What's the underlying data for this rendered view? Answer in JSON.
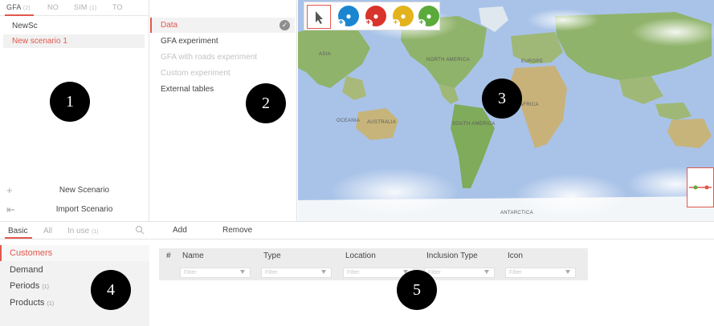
{
  "left_panel": {
    "mode_tabs": [
      {
        "label": "GFA",
        "count": "(2)"
      },
      {
        "label": "NO",
        "count": ""
      },
      {
        "label": "SIM",
        "count": "(1)"
      },
      {
        "label": "TO",
        "count": ""
      }
    ],
    "scenarios": [
      "NewSc",
      "New scenario 1"
    ],
    "actions": {
      "new_scenario": "New Scenario",
      "import_scenario": "Import Scenario"
    }
  },
  "data_panel": {
    "items": [
      "Data",
      "GFA experiment",
      "GFA with roads experiment",
      "Custom experiment",
      "External tables"
    ]
  },
  "map": {
    "labels": [
      "ASIA",
      "AUSTRALIA",
      "EUROPE",
      "AFRICA",
      "NORTH AMERICA",
      "SOUTH AMERICA",
      "OCEANIA",
      "ANTARCTICA"
    ],
    "tools": [
      "pointer-icon",
      "add-customer-icon",
      "add-warehouse-icon",
      "add-supplier-icon",
      "add-site-icon"
    ],
    "colors": {
      "blue": "#1a86d0",
      "red": "#d8342b",
      "yellow": "#e3b31c",
      "green": "#5aab3c",
      "accent": "#e2574c"
    }
  },
  "bottom_tabs": [
    {
      "label": "Basic",
      "count": ""
    },
    {
      "label": "All",
      "count": ""
    },
    {
      "label": "In use",
      "count": "(1)"
    }
  ],
  "table_toolbar": {
    "add": "Add",
    "remove": "Remove"
  },
  "entity_list": [
    {
      "label": "Customers",
      "count": ""
    },
    {
      "label": "Demand",
      "count": ""
    },
    {
      "label": "Periods",
      "count": "(1)"
    },
    {
      "label": "Products",
      "count": "(1)"
    }
  ],
  "table": {
    "columns": [
      "#",
      "Name",
      "Type",
      "Location",
      "Inclusion Type",
      "Icon"
    ],
    "filter_placeholder": "Filter"
  },
  "callouts": [
    "1",
    "2",
    "3",
    "4",
    "5"
  ]
}
